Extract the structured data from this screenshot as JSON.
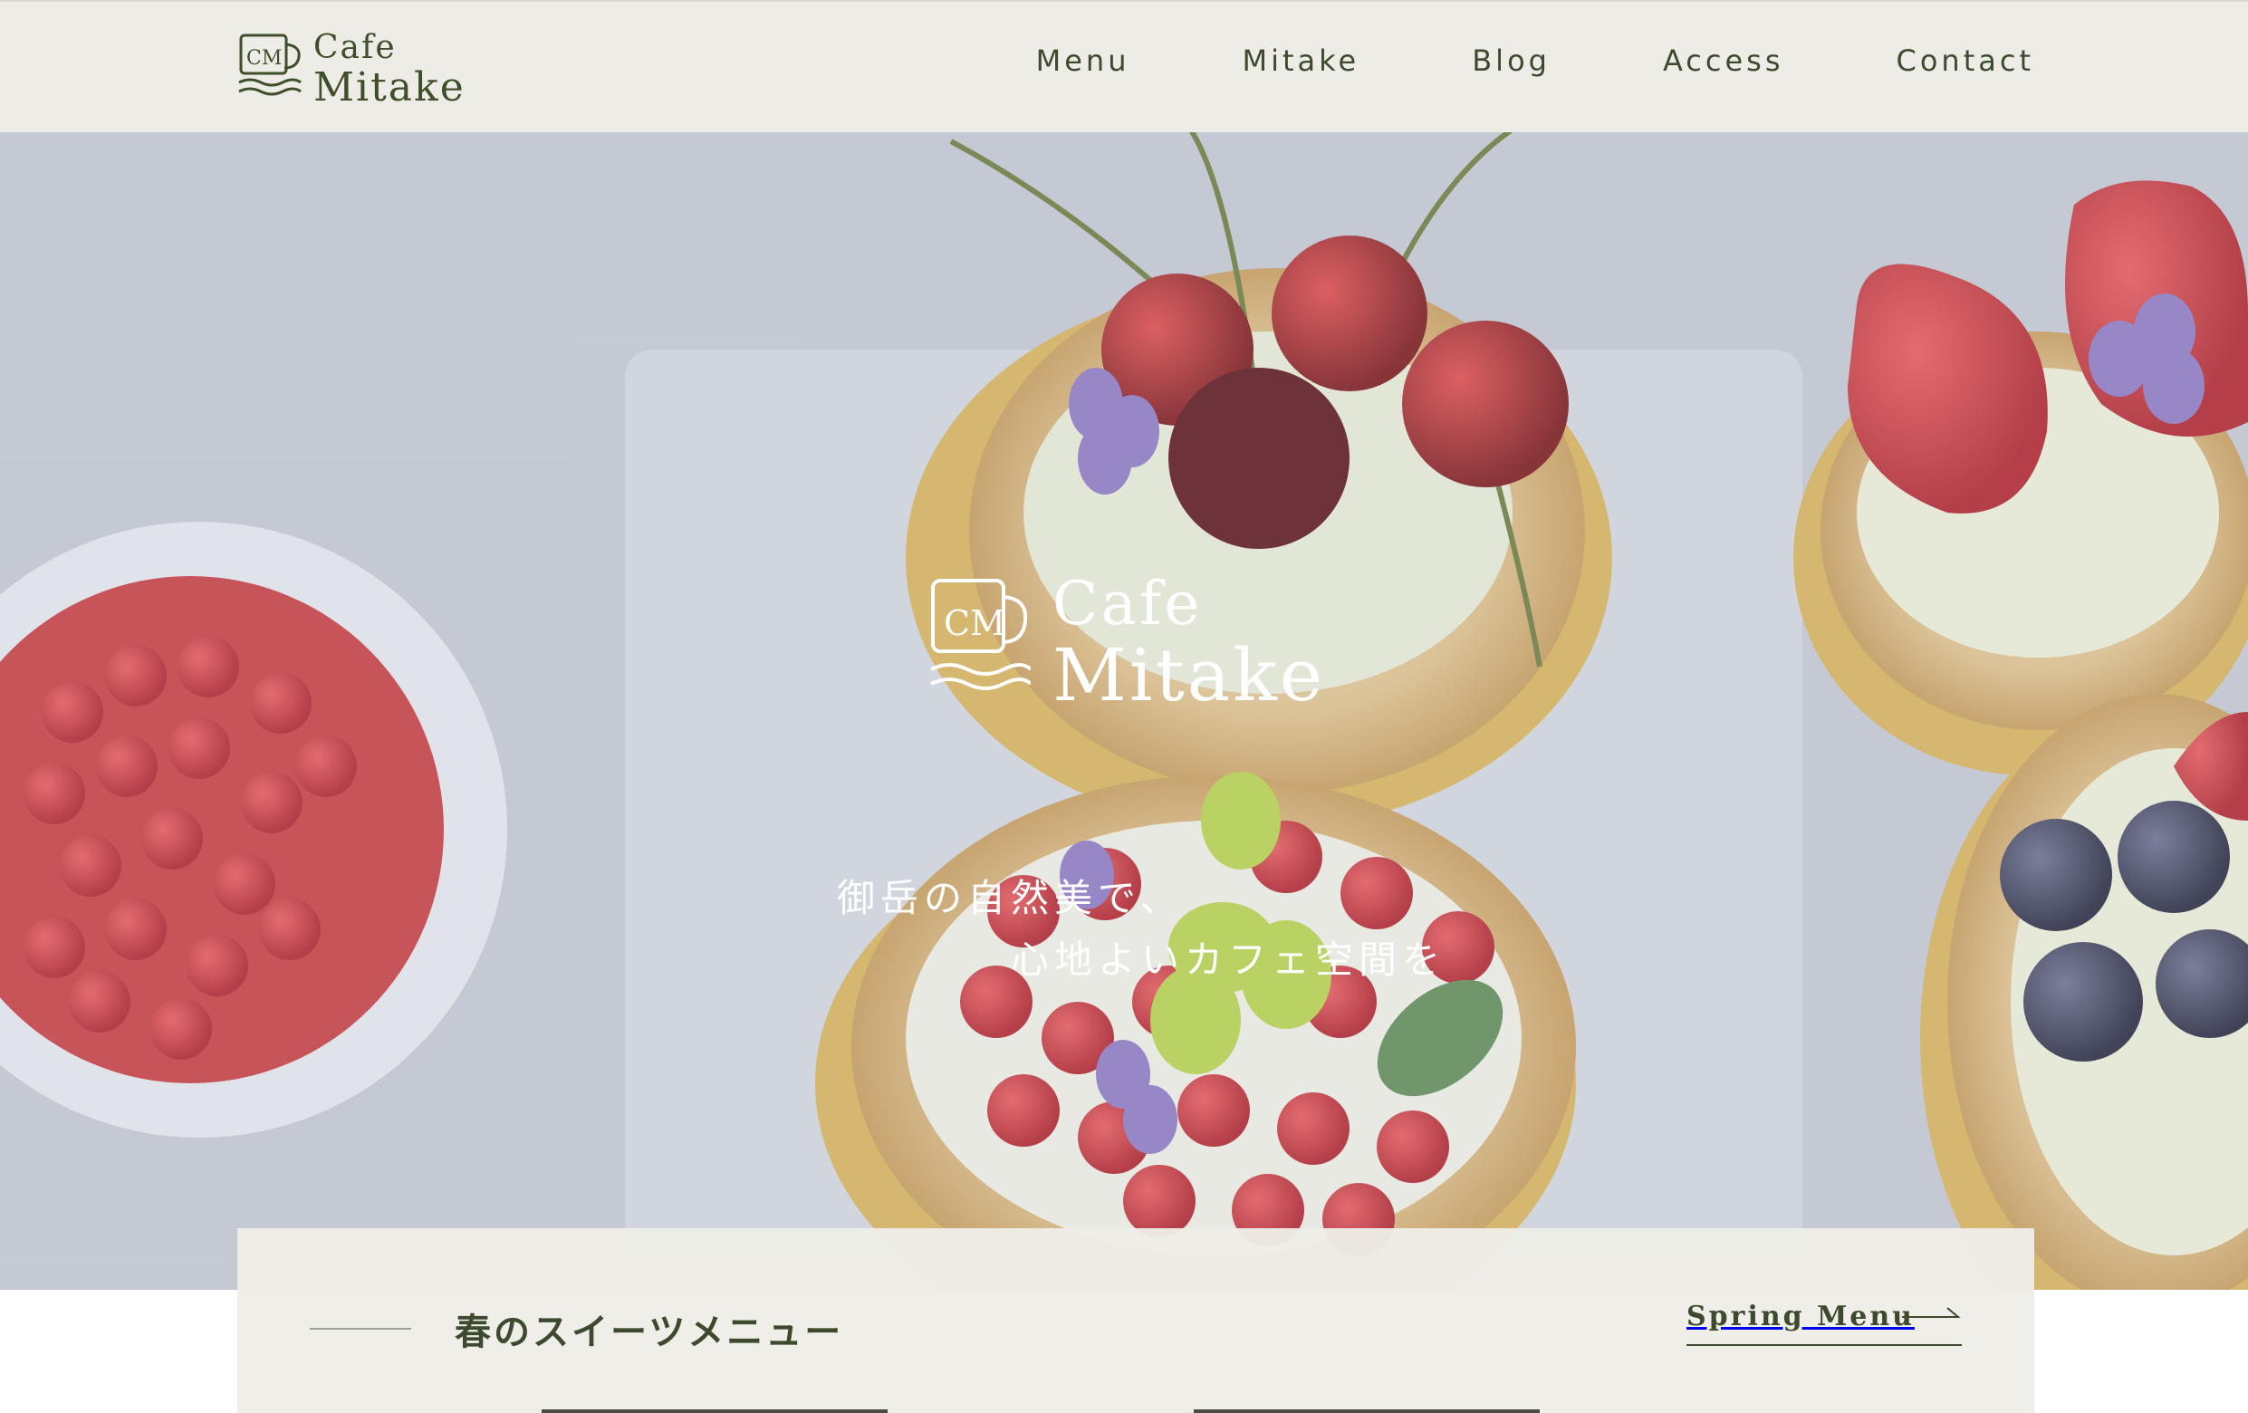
{
  "brand": {
    "line1": "Cafe",
    "line2": "Mitake",
    "mark": "CM"
  },
  "nav": {
    "items": [
      "Menu",
      "Mitake",
      "Blog",
      "Access",
      "Contact"
    ]
  },
  "hero": {
    "logo_line1": "Cafe",
    "logo_line2": "Mitake",
    "logo_mark": "CM",
    "tagline_line1": "御岳の自然美で、",
    "tagline_line2": "心地よいカフェ空間を",
    "image": "fruit-tarts-photo"
  },
  "feature": {
    "title": "春のスイーツメニュー",
    "link_label": "Spring Menu",
    "link_icon": "arrow-right-icon"
  },
  "colors": {
    "accent": "#3d4a2e",
    "header_bg": "#edece6",
    "card_bg": "#eeede7"
  }
}
